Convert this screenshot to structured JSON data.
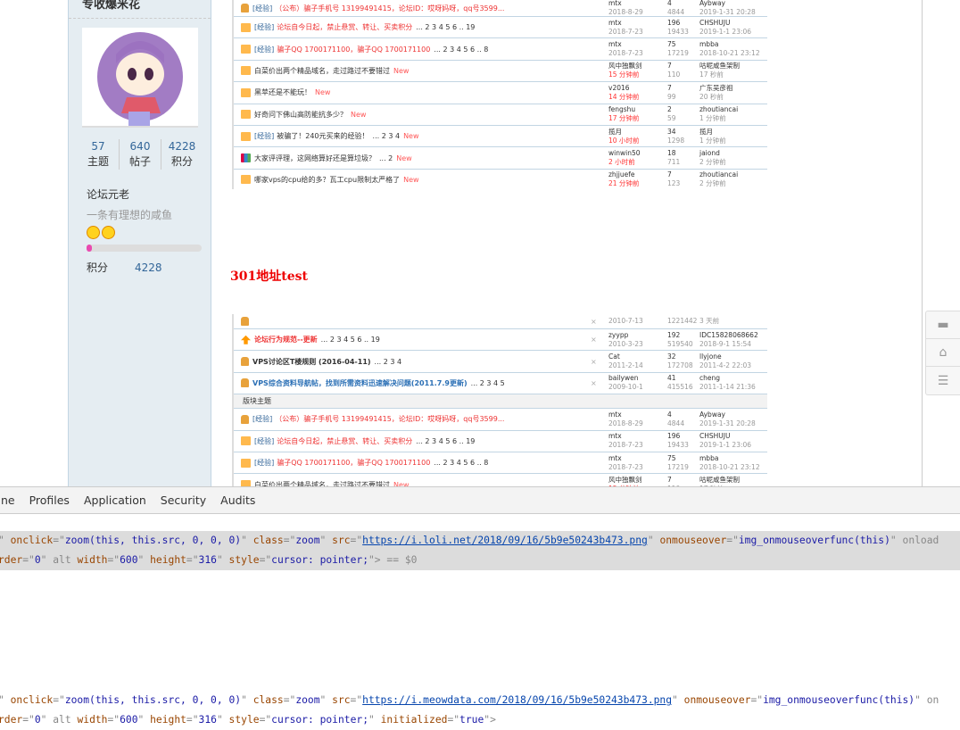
{
  "sidebar": {
    "username": "专收爆米花",
    "stats": [
      {
        "value": "57",
        "label": "主题"
      },
      {
        "value": "640",
        "label": "帖子"
      },
      {
        "value": "4228",
        "label": "积分"
      }
    ],
    "rank": "论坛元老",
    "motto": "一条有理想的咸鱼",
    "progress_percent": 5,
    "score_label": "积分",
    "score_value": "4228"
  },
  "post": {
    "heading": "301地址test"
  },
  "image1_rows": [
    {
      "icon": "lock",
      "tag": "[经验]",
      "title": "（公布）骗子手机号 13199491415，论坛ID：哎呀妈呀，qq号3599...",
      "style": "red",
      "pages": "",
      "new": "",
      "author": "mtx",
      "date": "2018-8-29",
      "hot": false,
      "replies": "4",
      "views": "4844",
      "last": "Aybway",
      "lastTime": "2019-1-31 20:28"
    },
    {
      "icon": "folder",
      "tag": "[经验]",
      "title": "论坛自今日起，禁止悬赏、转让、买卖积分",
      "style": "red",
      "pages": "... 2 3 4 5 6 .. 19",
      "new": "",
      "author": "mtx",
      "date": "2018-7-23",
      "hot": false,
      "replies": "196",
      "views": "19433",
      "last": "CHSHUJU",
      "lastTime": "2019-1-1 23:06"
    },
    {
      "icon": "folder",
      "tag": "[经验]",
      "title": "骗子QQ 1700171100，骗子QQ 1700171100",
      "style": "red",
      "pages": "... 2 3 4 5 6 .. 8",
      "new": "",
      "author": "mtx",
      "date": "2018-7-23",
      "hot": false,
      "replies": "75",
      "views": "17219",
      "last": "mbba",
      "lastTime": "2018-10-21 23:12"
    },
    {
      "icon": "folder",
      "tag": "",
      "title": "白菜价出两个精品域名，走过路过不要错过",
      "style": "",
      "pages": "",
      "new": "New",
      "author": "风中独飘剑",
      "date": "15 分钟前",
      "hot": true,
      "replies": "7",
      "views": "110",
      "last": "咕呢咸鱼架制",
      "lastTime": "17 秒前"
    },
    {
      "icon": "folder",
      "tag": "",
      "title": "黑苹还是不能玩！",
      "style": "",
      "pages": "",
      "new": "New",
      "author": "v2016",
      "date": "14 分钟前",
      "hot": true,
      "replies": "7",
      "views": "99",
      "last": "广东吴彦祖",
      "lastTime": "20 秒前"
    },
    {
      "icon": "folder",
      "tag": "",
      "title": "好奇问下佛山高防能抗多少？",
      "style": "",
      "pages": "",
      "new": "New",
      "author": "fengshu",
      "date": "17 分钟前",
      "hot": true,
      "replies": "2",
      "views": "59",
      "last": "zhoutiancai",
      "lastTime": "1 分钟前"
    },
    {
      "icon": "folder",
      "tag": "[经验]",
      "title": "被骗了！240元买来的经验！",
      "style": "",
      "pages": "... 2 3 4",
      "new": "New",
      "author": "揽月",
      "date": "10 小时前",
      "hot": true,
      "replies": "34",
      "views": "1298",
      "last": "揽月",
      "lastTime": "1 分钟前"
    },
    {
      "icon": "chart",
      "tag": "",
      "title": "大家评评理，这网络算好还是算垃圾？",
      "style": "",
      "pages": "... 2",
      "new": "New",
      "author": "winwin50",
      "date": "2 小时前",
      "hot": true,
      "replies": "18",
      "views": "711",
      "last": "jaiond",
      "lastTime": "2 分钟前"
    },
    {
      "icon": "folder",
      "tag": "",
      "title": "哪家vps的cpu给的多？瓦工cpu限制太严格了",
      "style": "",
      "pages": "",
      "new": "New",
      "author": "zhjjuefe",
      "date": "21 分钟前",
      "hot": true,
      "replies": "7",
      "views": "123",
      "last": "zhoutiancai",
      "lastTime": "2 分钟前"
    }
  ],
  "image2_top_rows": [
    {
      "icon": "lock",
      "tag": "",
      "title": "",
      "style": "red",
      "pages": "",
      "new": "",
      "author": "",
      "date": "2010-7-13",
      "hot": false,
      "replies": "",
      "views": "1221442",
      "last": "",
      "lastTime": "3 天前",
      "close": "×"
    },
    {
      "icon": "up",
      "tag": "",
      "title": "论坛行为规范--更新",
      "style": "redb",
      "pages": "... 2 3 4 5 6 .. 19",
      "new": "",
      "author": "zyypp",
      "date": "2010-3-23",
      "hot": false,
      "replies": "192",
      "views": "519540",
      "last": "IDC15828068662",
      "lastTime": "2018-9-1 15:54",
      "close": "×"
    },
    {
      "icon": "lock",
      "tag": "",
      "title": "VPS讨论区T楼规则 (2016-04-11)",
      "style": "bold",
      "pages": "... 2 3 4",
      "new": "",
      "author": "Cat",
      "date": "2011-2-14",
      "hot": false,
      "replies": "32",
      "views": "172708",
      "last": "llyjone",
      "lastTime": "2011-4-2 22:03",
      "close": "×"
    },
    {
      "icon": "lock",
      "tag": "",
      "title": "VPS综合资料导航帖，找到所需资料迅速解决问题(2011.7.9更新)",
      "style": "blue",
      "pages": "... 2 3 4 5",
      "new": "",
      "author": "bailywen",
      "date": "2009-10-1",
      "hot": false,
      "replies": "41",
      "views": "415516",
      "last": "cheng",
      "lastTime": "2011-1-14 21:36",
      "close": "×"
    }
  ],
  "image2_section": "版块主题",
  "devtools": {
    "tabs": [
      "line",
      "Profiles",
      "Application",
      "Security",
      "Audits"
    ],
    "line1a": [
      "\" ",
      "onclick",
      "=\"",
      "zoom(this, this.src, 0, 0, 0)",
      "\" ",
      "class",
      "=\"",
      "zoom",
      "\" ",
      "src",
      "=\"",
      "https://i.loli.net/2018/09/16/5b9e50243b473.png",
      "\" ",
      "onmouseover",
      "=\"",
      "img_onmouseoverfunc(this)",
      "\" ",
      "onload"
    ],
    "line1b": [
      "rder",
      "=\"",
      "0",
      "\" ",
      "alt",
      " ",
      "width",
      "=\"",
      "600",
      "\" ",
      "height",
      "=\"",
      "316",
      "\" ",
      "style",
      "=\"",
      "cursor: pointer;",
      "\">",
      " == $0"
    ],
    "line2a": [
      "\" ",
      "onclick",
      "=\"",
      "zoom(this, this.src, 0, 0, 0)",
      "\" ",
      "class",
      "=\"",
      "zoom",
      "\" ",
      "src",
      "=\"",
      "https://i.meowdata.com/2018/09/16/5b9e50243b473.png",
      "\" ",
      "onmouseover",
      "=\"",
      "img_onmouseoverfunc(this)",
      "\" ",
      "on"
    ],
    "line2b": [
      "rder",
      "=\"",
      "0",
      "\" ",
      "alt",
      " ",
      "width",
      "=\"",
      "600",
      "\" ",
      "height",
      "=\"",
      "316",
      "\" ",
      "style",
      "=\"",
      "cursor: pointer;",
      "\" ",
      "initialized",
      "=\"",
      "true",
      "\">"
    ]
  },
  "floatbar": [
    "comment-icon",
    "back-to-top-icon",
    "list-icon"
  ]
}
